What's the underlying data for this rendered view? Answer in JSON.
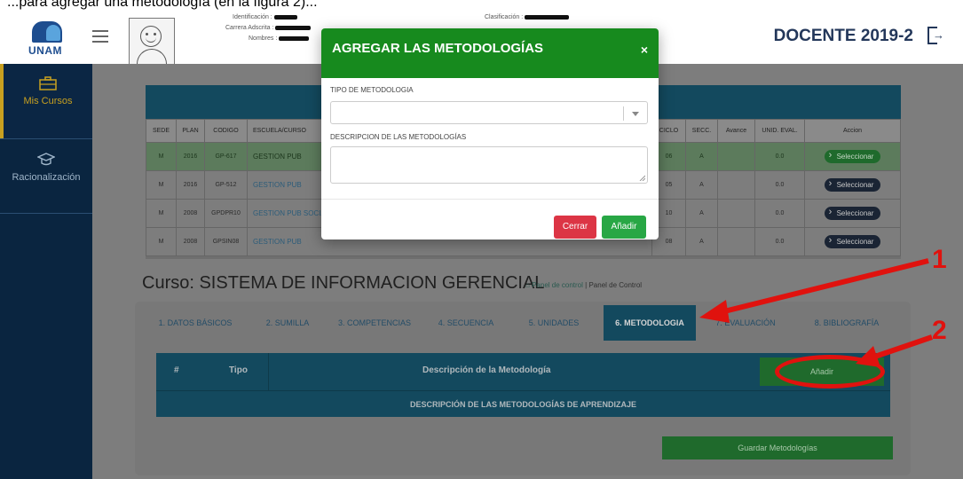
{
  "caption": {
    "text": "...para agregar una metodología (en la figura 2)..."
  },
  "header": {
    "logo_text": "UNAM",
    "id_label": "Identificación :",
    "carrera_label": "Carrera Adscrita :",
    "nombres_label": "Nombres :",
    "clasificacion_label": "Clasificación :",
    "title": "DOCENTE 2019-2"
  },
  "sidebar": {
    "items": [
      {
        "label": "Mis Cursos"
      },
      {
        "label": "Racionalización"
      }
    ]
  },
  "table": {
    "headers": [
      "SEDE",
      "PLAN",
      "CODIGO",
      "ESCUELA/CURSO",
      "CICLO",
      "SECC.",
      "Avance",
      "UNID. EVAL.",
      "Accion"
    ],
    "rows": [
      {
        "sede": "M",
        "plan": "2016",
        "codigo": "GP-617",
        "escuela": "GESTION PUB",
        "ciclo": "06",
        "secc": "A",
        "avance": "",
        "unid": "0.0",
        "accion": "Seleccionar"
      },
      {
        "sede": "M",
        "plan": "2016",
        "codigo": "GP-512",
        "escuela": "GESTION PUB",
        "ciclo": "05",
        "secc": "A",
        "avance": "",
        "unid": "0.0",
        "accion": "Seleccionar"
      },
      {
        "sede": "M",
        "plan": "2008",
        "codigo": "GPDPR10",
        "escuela": "GESTION PUB SOCIAL /",
        "ciclo": "10",
        "secc": "A",
        "avance": "",
        "unid": "0.0",
        "accion": "Seleccionar"
      },
      {
        "sede": "M",
        "plan": "2008",
        "codigo": "GPSIN08",
        "escuela": "GESTION PUB",
        "ciclo": "08",
        "secc": "A",
        "avance": "",
        "unid": "0.0",
        "accion": "Seleccionar"
      }
    ]
  },
  "course": {
    "title": "Curso: SISTEMA DE INFORMACION GERENCIAL",
    "breadcrumb_home": "Panel de control",
    "breadcrumb_sep": "|",
    "breadcrumb_current": "Panel de Control"
  },
  "tabs": [
    {
      "label": "1. DATOS BÁSICOS"
    },
    {
      "label": "2. SUMILLA"
    },
    {
      "label": "3. COMPETENCIAS"
    },
    {
      "label": "4. SECUENCIA"
    },
    {
      "label": "5. UNIDADES"
    },
    {
      "label": "6. METODOLOGIA"
    },
    {
      "label": "7. EVALUACIÓN"
    },
    {
      "label": "8. BIBLIOGRAFÍA"
    }
  ],
  "metodologia": {
    "col_num": "#",
    "col_tipo": "Tipo",
    "col_desc": "Descripción de la Metodología",
    "add_label": "Añadir",
    "row_title": "DESCRIPCIÓN DE LAS METODOLOGÍAS DE APRENDIZAJE",
    "save_label": "Guardar Metodologías"
  },
  "modal": {
    "title": "AGREGAR LAS METODOLOGÍAS",
    "close": "×",
    "tipo_label": "TIPO DE METODOLOGIA",
    "tipo_value": "",
    "desc_label": "DESCRIPCION DE LAS METODOLOGÍAS",
    "desc_value": "",
    "cerrar_label": "Cerrar",
    "anadir_label": "Añadir"
  },
  "annotations": {
    "n1": "1",
    "n2": "2"
  },
  "colors": {
    "modal_header": "#178a1e",
    "sidebar": "#0a2540",
    "accent_red": "#e0120e",
    "teal": "#13495e"
  }
}
